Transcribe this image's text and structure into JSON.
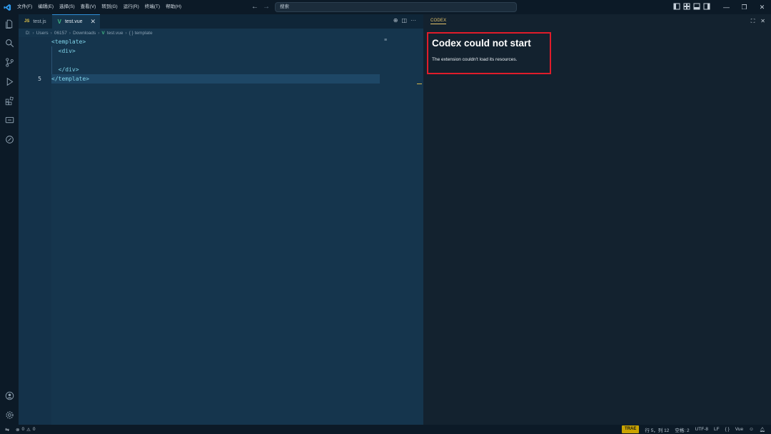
{
  "titlebar": {
    "menu": [
      "文件(F)",
      "编辑(E)",
      "选择(S)",
      "查看(V)",
      "转到(G)",
      "运行(R)",
      "终端(T)",
      "帮助(H)"
    ],
    "search_placeholder": "搜索",
    "accent": "#2e8fd6"
  },
  "tabs": [
    {
      "label": "test.js",
      "icon": "js-file-icon",
      "badge": "JS"
    },
    {
      "label": "test.vue",
      "icon": "vue-file-icon",
      "badge": "V",
      "active": true
    }
  ],
  "breadcrumb": [
    "D:",
    "Users",
    "06157",
    "Downloads",
    "test.vue",
    "{ } template"
  ],
  "editor": {
    "lines": [
      "<template>",
      "  <div>",
      "",
      "  </div>",
      "</template>"
    ],
    "current_line_number": "5",
    "code_color": "#7fd3e8"
  },
  "panel": {
    "tab_label": "CODEX",
    "error_title": "Codex could not start",
    "error_message": "The extension couldn't load its resources.",
    "highlight_color": "#e01c2a"
  },
  "statusbar": {
    "errors": "0",
    "warnings": "0",
    "badge": "TRAE",
    "position": "行 5，列 12",
    "indent": "空格: 2",
    "encoding": "UTF-8",
    "eol": "LF",
    "language": "Vue"
  }
}
